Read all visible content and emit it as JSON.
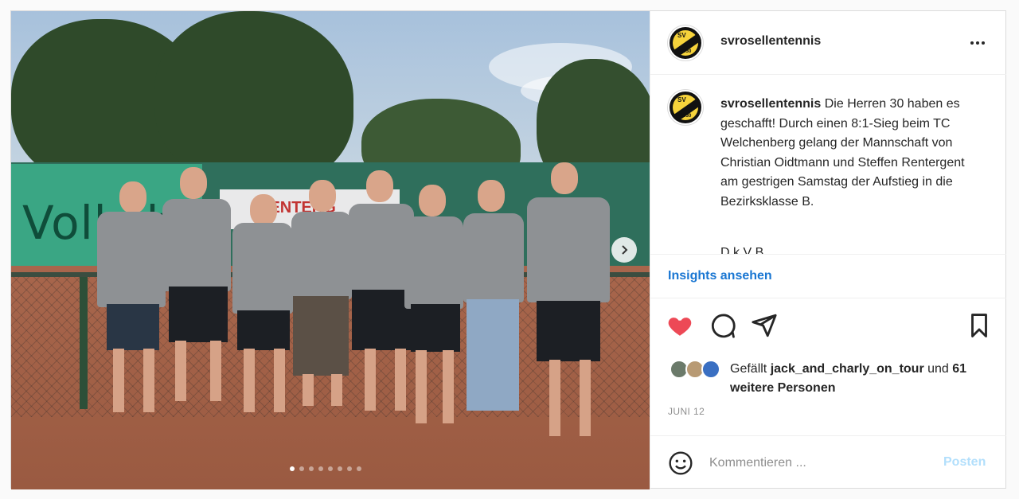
{
  "post": {
    "username": "svrosellentennis",
    "caption_user": "svrosellentennis",
    "caption_text": "Die Herren 30 haben es geschafft! Durch einen 8:1-Sieg beim TC Welchenberg gelang der Mannschaft von Christian Oidtmann und Steffen Rentergent am gestrigen Samstag der Aufstieg in die Bezirksklasse B.",
    "caption_cut": "D   k                     V       B",
    "insights_label": "Insights ansehen",
    "likes_prefix": "Gefällt",
    "likes_user": "jack_and_charly_on_tour",
    "likes_and": "und",
    "likes_others": "61 weitere Personen",
    "date": "JUNI 12",
    "comment_placeholder": "Kommentieren ...",
    "post_label": "Posten"
  },
  "photo": {
    "banner_left_text": "Volksba",
    "banner_mid_text": "RENTERG",
    "slide_count": 8,
    "active_slide": 1
  },
  "logo": {
    "top_text": "SV",
    "year": "1930"
  },
  "icons": {
    "more": "more-options-icon",
    "like": "heart-icon",
    "comment": "comment-icon",
    "share": "share-icon",
    "save": "bookmark-icon",
    "emoji": "emoji-icon",
    "next": "chevron-right-icon"
  },
  "colors": {
    "like_red": "#ed4956",
    "link_blue": "#1976d2",
    "post_disabled": "#b2dffc",
    "logo_yellow": "#f6d33b"
  }
}
